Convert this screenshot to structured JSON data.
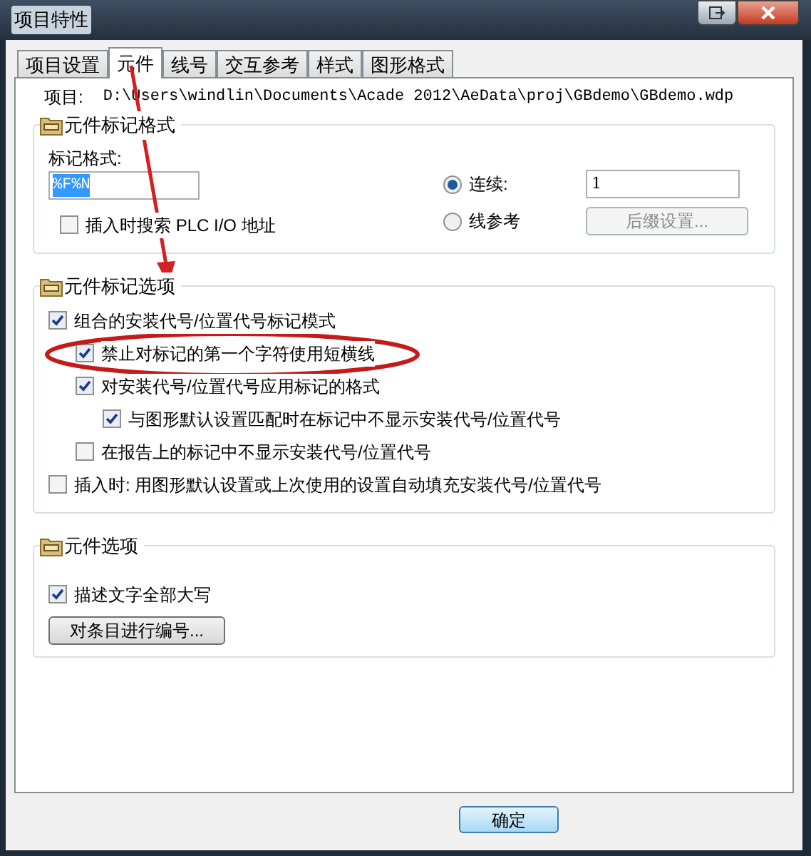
{
  "window": {
    "title": "项目特性"
  },
  "tabs": [
    {
      "label": "项目设置",
      "selected": false
    },
    {
      "label": "元件",
      "selected": true
    },
    {
      "label": "线号",
      "selected": false
    },
    {
      "label": "交互参考",
      "selected": false
    },
    {
      "label": "样式",
      "selected": false
    },
    {
      "label": "图形格式",
      "selected": false
    }
  ],
  "project": {
    "label": "项目:",
    "path": "D:\\Users\\windlin\\Documents\\Acade 2012\\AeData\\proj\\GBdemo\\GBdemo.wdp"
  },
  "tag_format_group": {
    "title": "元件标记格式",
    "format_label": "标记格式:",
    "format_value": "%F%N",
    "search_plc": {
      "label": "插入时搜索 PLC I/O 地址",
      "checked": false
    },
    "modes": [
      {
        "label": "连续:",
        "selected": true
      },
      {
        "label": "线参考",
        "selected": false
      }
    ],
    "sequential_value": "1",
    "suffix_button": {
      "label": "后缀设置...",
      "disabled": true
    }
  },
  "tag_options_group": {
    "title": "元件标记选项",
    "items": [
      {
        "label": "组合的安装代号/位置代号标记模式",
        "checked": true,
        "children": [
          {
            "label": "禁止对标记的第一个字符使用短横线",
            "checked": true
          },
          {
            "label": "对安装代号/位置代号应用标记的格式",
            "checked": true,
            "children": [
              {
                "label": "与图形默认设置匹配时在标记中不显示安装代号/位置代号",
                "checked": true
              }
            ]
          },
          {
            "label": "在报告上的标记中不显示安装代号/位置代号",
            "checked": false
          }
        ]
      },
      {
        "label": "插入时: 用图形默认设置或上次使用的设置自动填充安装代号/位置代号",
        "checked": false
      }
    ]
  },
  "component_options_group": {
    "title": "元件选项",
    "uppercase": {
      "label": "描述文字全部大写",
      "checked": true
    },
    "renumber_button": "对条目进行编号..."
  },
  "ok_button": "确定"
}
